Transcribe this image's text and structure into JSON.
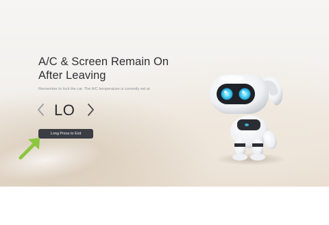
{
  "screen": {
    "title": "A/C & Screen Remain On After Leaving",
    "subtitle": "Remember to lock the car. The A/C temperature is currently set at",
    "temperature": {
      "value": "LO",
      "decrease_icon": "chevron-left-icon",
      "increase_icon": "chevron-right-icon"
    },
    "exit_button_label": "Long Press to Exit",
    "hint_icon": "pointer-arrow-icon",
    "illustration": "robot-dog-icon"
  },
  "colors": {
    "title": "#2f3035",
    "button_bg": "#3b3d44",
    "hint_arrow": "#8cc63f",
    "robot_eyes": "#45d3ff"
  }
}
